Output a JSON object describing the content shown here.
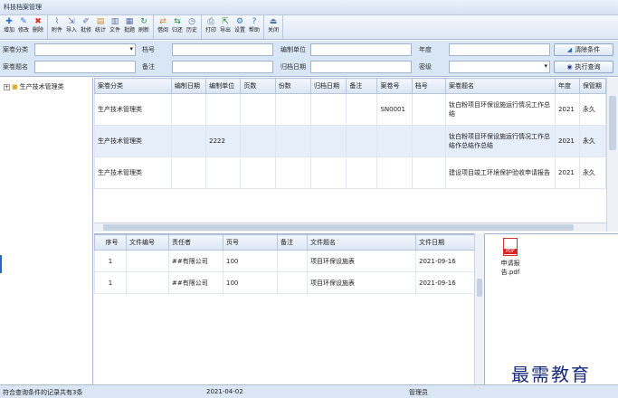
{
  "window": {
    "title": "科技档案管理"
  },
  "toolbar": {
    "groups": [
      [
        {
          "icon": "add-icon",
          "glyph": "✚",
          "label": "增加",
          "color": "#2b6fd0"
        },
        {
          "icon": "edit-icon",
          "glyph": "✎",
          "label": "修改",
          "color": "#2b6fd0"
        },
        {
          "icon": "delete-icon",
          "glyph": "✖",
          "label": "删除",
          "color": "#d0322b"
        }
      ],
      [
        {
          "icon": "attach-icon",
          "glyph": "⌇",
          "label": "附件",
          "color": "#5a6fa8"
        },
        {
          "icon": "import-icon",
          "glyph": "⇲",
          "label": "导入",
          "color": "#5a6fa8"
        },
        {
          "icon": "batch-edit-icon",
          "glyph": "✐",
          "label": "批修",
          "color": "#5a6fa8"
        },
        {
          "icon": "stats-icon",
          "glyph": "▤",
          "label": "统计",
          "color": "#d08a2b"
        },
        {
          "icon": "file-icon",
          "glyph": "▥",
          "label": "文件",
          "color": "#5a6fa8"
        },
        {
          "icon": "batch-icon",
          "glyph": "▦",
          "label": "批题",
          "color": "#5a6fa8"
        },
        {
          "icon": "refresh-icon",
          "glyph": "↻",
          "label": "刷新",
          "color": "#2b8a3a"
        }
      ],
      [
        {
          "icon": "borrow-icon",
          "glyph": "⇄",
          "label": "借阅",
          "color": "#d08a2b"
        },
        {
          "icon": "return-icon",
          "glyph": "⇆",
          "label": "归还",
          "color": "#2b8a3a"
        },
        {
          "icon": "history-icon",
          "glyph": "◷",
          "label": "历史",
          "color": "#5a6fa8"
        }
      ],
      [
        {
          "icon": "print-icon",
          "glyph": "⎙",
          "label": "打印",
          "color": "#5a6fa8"
        },
        {
          "icon": "export-icon",
          "glyph": "⇱",
          "label": "导出",
          "color": "#2b8a3a"
        },
        {
          "icon": "settings-icon",
          "glyph": "⚙",
          "label": "设置",
          "color": "#2b6fd0"
        },
        {
          "icon": "help-icon",
          "glyph": "?",
          "label": "帮助",
          "color": "#2b6fd0"
        }
      ],
      [
        {
          "icon": "close-icon",
          "glyph": "⏏",
          "label": "关闭",
          "color": "#5a6fa8"
        }
      ]
    ]
  },
  "filters": {
    "category_label": "案卷分类",
    "file_no_label": "档号",
    "unit_label": "编制单位",
    "year_label": "年度",
    "title_label": "案卷题名",
    "note_label": "备注",
    "archive_date_label": "归档日期",
    "security_label": "密级",
    "clear_button": "清除条件",
    "query_button": "执行查询"
  },
  "tree": {
    "root_label": "生产技术管理类"
  },
  "main_table": {
    "columns": [
      "案卷分类",
      "编制日期",
      "编制单位",
      "页数",
      "份数",
      "归档日期",
      "备注",
      "案卷号",
      "档号",
      "案卷题名",
      "年度",
      "保管期"
    ],
    "rows": [
      [
        "生产技术管理类",
        "",
        "",
        "",
        "",
        "",
        "",
        "SN0001",
        "",
        "钛白粉项目环保设施运行情况工作总结",
        "2021",
        "永久"
      ],
      [
        "生产技术管理类",
        "",
        "2222",
        "",
        "",
        "",
        "",
        "",
        "",
        "钛白粉项目环保设施运行情况工作总结作总结作总结",
        "2021",
        "永久"
      ],
      [
        "生产技术管理类",
        "",
        "",
        "",
        "",
        "",
        "",
        "",
        "",
        "建设项目竣工环境保护验收申请报告",
        "2021",
        "永久"
      ]
    ]
  },
  "file_table": {
    "columns": [
      "序号",
      "文件编号",
      "责任者",
      "页号",
      "备注",
      "文件题名",
      "文件日期"
    ],
    "rows": [
      [
        "1",
        "",
        "##有限公司",
        "100",
        "",
        "项目环保设施表",
        "2021-09-16"
      ],
      [
        "1",
        "",
        "##有限公司",
        "100",
        "",
        "项目环保设施表",
        "2021-09-16"
      ]
    ]
  },
  "attachment": {
    "icon": "pdf-icon",
    "name": "申请报告.pdf"
  },
  "watermark": "最需教育",
  "status": {
    "records": "符合查询条件的记录共有3条",
    "date": "2021-04-02",
    "user": "管理员"
  }
}
